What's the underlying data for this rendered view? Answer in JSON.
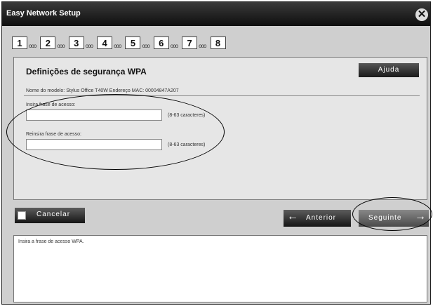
{
  "window": {
    "title": "Easy Network Setup",
    "close_glyph": "✕"
  },
  "steps": [
    {
      "num": "1",
      "dots": "ooo"
    },
    {
      "num": "2",
      "dots": "ooo"
    },
    {
      "num": "3",
      "dots": "ooo"
    },
    {
      "num": "4",
      "dots": "ooo"
    },
    {
      "num": "5",
      "dots": "ooo"
    },
    {
      "num": "6",
      "dots": "ooo"
    },
    {
      "num": "7",
      "dots": "ooo"
    },
    {
      "num": "8",
      "dots": ""
    }
  ],
  "panel": {
    "heading": "Definições de segurança WPA",
    "help_label": "Ajuda",
    "model_info": "Nome do modelo: Stylus Office T40W   Endereço MAC: 00004847A207",
    "field1_label": "Insira frase de acesso:",
    "field1_value": "",
    "field1_hint": "(8-63 caracteres)",
    "field2_label": "Reinsira frase de acesso:",
    "field2_value": "",
    "field2_hint": "(8-63 caracteres)"
  },
  "buttons": {
    "cancel_label": "Cancelar",
    "back_label": "Anterior",
    "back_icon": "←",
    "next_label": "Seguinte",
    "next_icon": "→"
  },
  "message": "Insira a frase de acesso WPA."
}
